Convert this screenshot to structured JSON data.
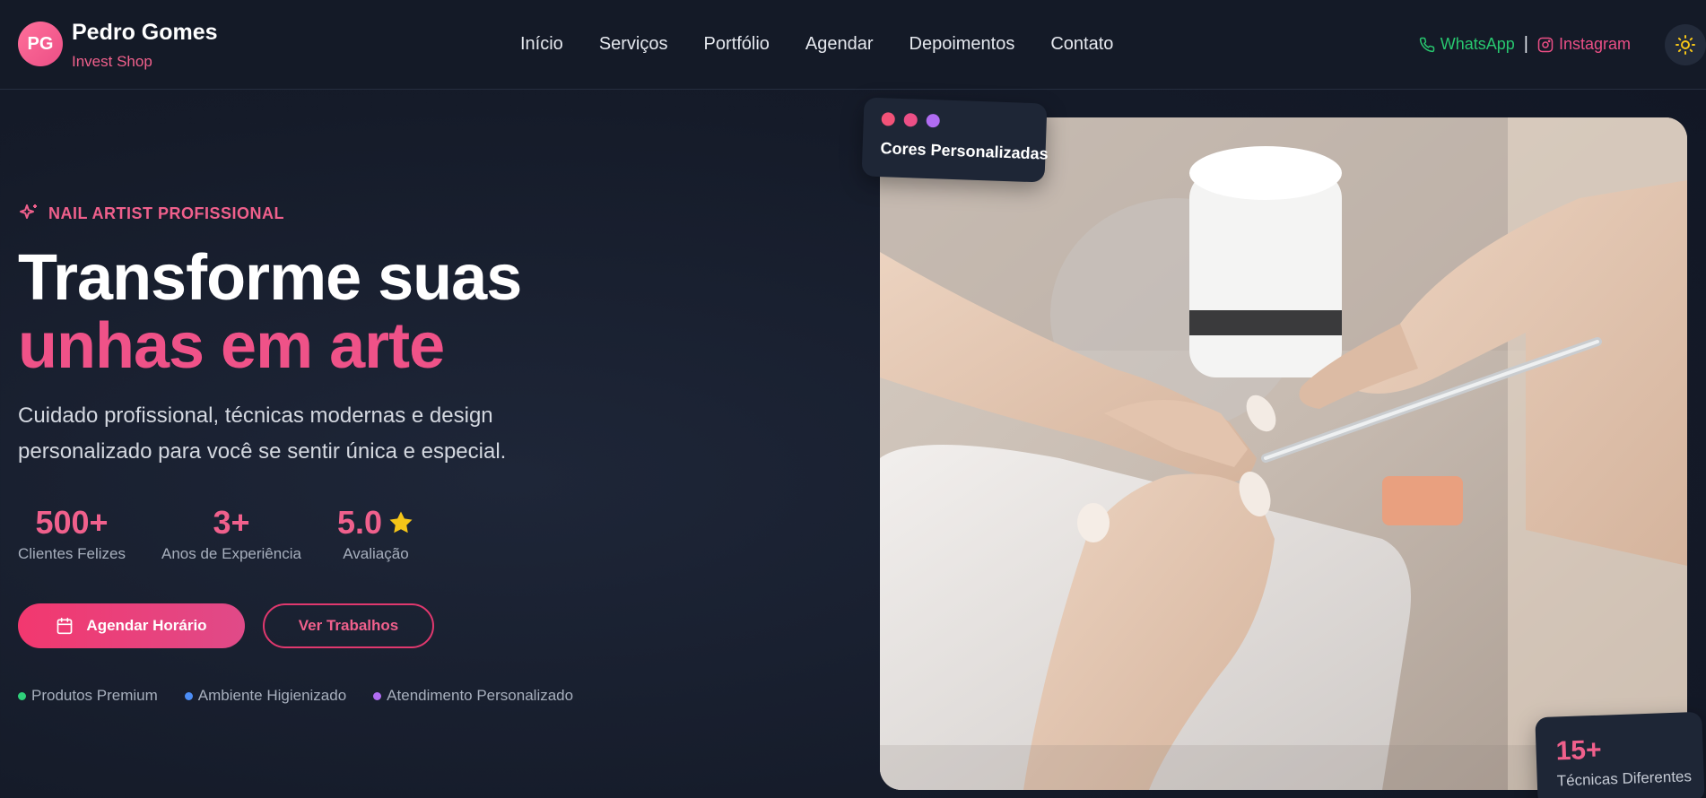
{
  "brand": {
    "initials": "PG",
    "name": "Pedro Gomes",
    "subtitle": "Invest Shop"
  },
  "nav": {
    "links": [
      "Início",
      "Serviços",
      "Portfólio",
      "Agendar",
      "Depoimentos",
      "Contato"
    ],
    "whatsapp": "WhatsApp",
    "separator": "|",
    "instagram": "Instagram"
  },
  "hero": {
    "eyebrow": "NAIL ARTIST PROFISSIONAL",
    "title_line1": "Transforme suas",
    "title_line2": "unhas em arte",
    "lead": "Cuidado profissional, técnicas modernas e design personalizado para você se sentir única e especial.",
    "stats": [
      {
        "value": "500+",
        "label": "Clientes Felizes"
      },
      {
        "value": "3+",
        "label": "Anos de Experiência"
      },
      {
        "value": "5.0",
        "label": "Avaliação"
      }
    ],
    "primary_button": "Agendar Horário",
    "secondary_button": "Ver Trabalhos",
    "features": [
      {
        "label": "Produtos Premium",
        "color": "#2fd07a"
      },
      {
        "label": "Ambiente Higienizado",
        "color": "#4c8df6"
      },
      {
        "label": "Atendimento Personalizado",
        "color": "#b06cf2"
      }
    ]
  },
  "cards": {
    "top": {
      "title": "Cores Personalizadas",
      "dots": [
        "#f25278",
        "#ec4f86",
        "#b06cf2"
      ]
    },
    "bottom": {
      "value": "15+",
      "label": "Técnicas Diferentes"
    }
  },
  "icons": {
    "theme": "sun-icon",
    "whatsapp": "phone-icon",
    "instagram": "instagram-icon",
    "eyebrow": "sparkles-icon",
    "calendar": "calendar-icon",
    "rating": "star-icon"
  },
  "colors": {
    "accent": "#f0608c",
    "background": "#151b29",
    "whatsapp": "#28c76f",
    "star": "#f5c518"
  }
}
